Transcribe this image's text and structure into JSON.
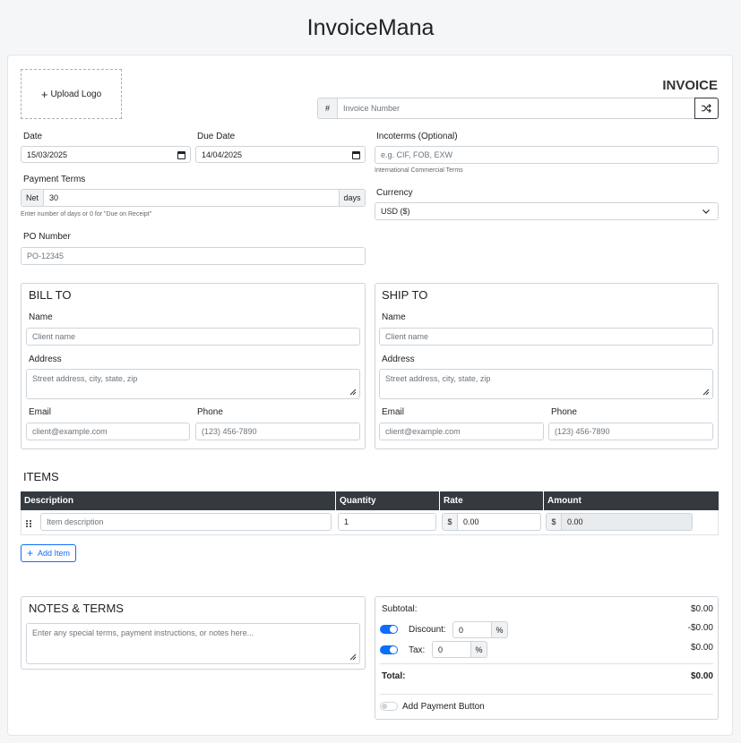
{
  "app": {
    "title": "InvoiceMana"
  },
  "logo": {
    "label": "Upload Logo"
  },
  "invoice": {
    "heading": "INVOICE",
    "number_prefix": "#",
    "number_placeholder": "Invoice Number"
  },
  "dates": {
    "date_label": "Date",
    "date_value": "15/03/2025",
    "due_label": "Due Date",
    "due_value": "14/04/2025"
  },
  "payment_terms": {
    "label": "Payment Terms",
    "prefix": "Net",
    "value": "30",
    "suffix": "days",
    "hint": "Enter number of days or 0 for \"Due on Receipt\""
  },
  "po": {
    "label": "PO Number",
    "placeholder": "PO-12345"
  },
  "incoterms": {
    "label": "Incoterms (Optional)",
    "placeholder": "e.g. CIF, FOB, EXW",
    "hint": "International Commercial Terms"
  },
  "currency": {
    "label": "Currency",
    "value": "USD ($)"
  },
  "bill_to": {
    "title": "BILL TO",
    "name_label": "Name",
    "name_placeholder": "Client name",
    "address_label": "Address",
    "address_placeholder": "Street address, city, state, zip",
    "email_label": "Email",
    "email_placeholder": "client@example.com",
    "phone_label": "Phone",
    "phone_placeholder": "(123) 456-7890"
  },
  "ship_to": {
    "title": "SHIP TO",
    "name_label": "Name",
    "name_placeholder": "Client name",
    "address_label": "Address",
    "address_placeholder": "Street address, city, state, zip",
    "email_label": "Email",
    "email_placeholder": "client@example.com",
    "phone_label": "Phone",
    "phone_placeholder": "(123) 456-7890"
  },
  "items": {
    "title": "ITEMS",
    "columns": [
      "Description",
      "Quantity",
      "Rate",
      "Amount"
    ],
    "rows": [
      {
        "description_placeholder": "Item description",
        "quantity": "1",
        "rate_prefix": "$",
        "rate": "0.00",
        "amount_prefix": "$",
        "amount": "0.00"
      }
    ],
    "add_label": "Add Item"
  },
  "notes": {
    "title": "NOTES & TERMS",
    "placeholder": "Enter any special terms, payment instructions, or notes here..."
  },
  "totals": {
    "subtotal_label": "Subtotal:",
    "subtotal_value": "$0.00",
    "discount_label": "Discount:",
    "discount_value": "0",
    "discount_unit": "%",
    "discount_amount": "-$0.00",
    "discount_enabled": true,
    "tax_label": "Tax:",
    "tax_value": "0",
    "tax_unit": "%",
    "tax_amount": "$0.00",
    "tax_enabled": true,
    "total_label": "Total:",
    "total_value": "$0.00",
    "payment_button_label": "Add Payment Button",
    "payment_button_enabled": false
  },
  "colors": {
    "accent": "#0d6efd",
    "table_header": "#343a40"
  }
}
